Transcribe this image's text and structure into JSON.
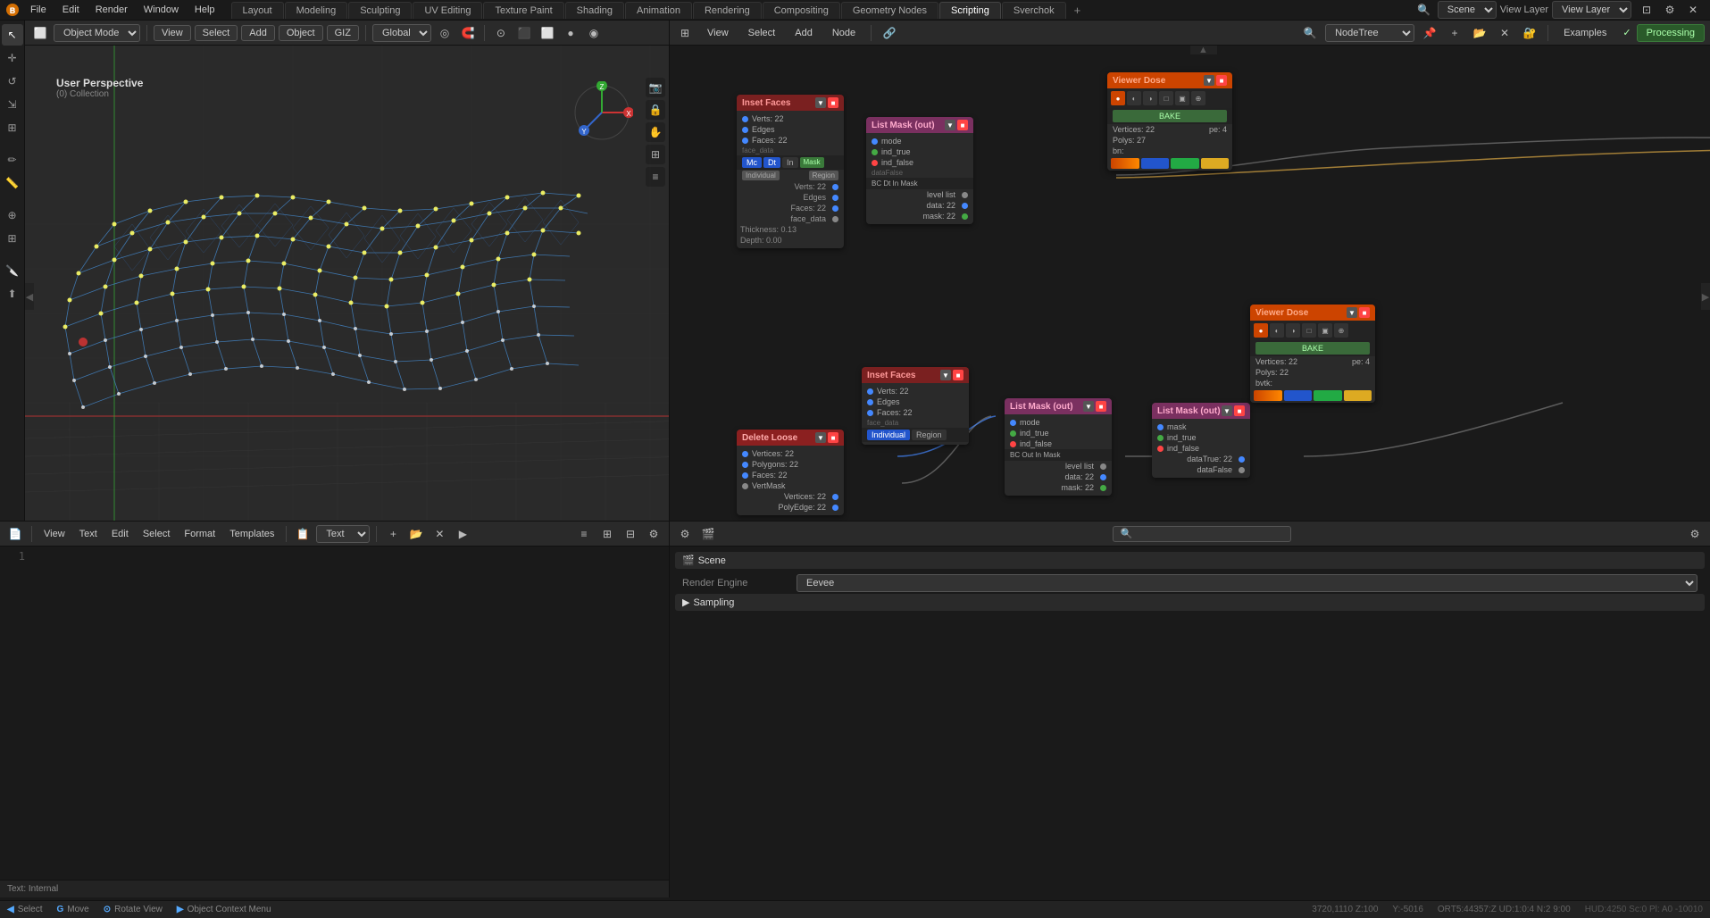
{
  "app": {
    "title": "Blender"
  },
  "topMenu": {
    "file": "File",
    "edit": "Edit",
    "render": "Render",
    "window": "Window",
    "help": "Help"
  },
  "workspaceTabs": [
    {
      "label": "Layout",
      "active": false
    },
    {
      "label": "Modeling",
      "active": false
    },
    {
      "label": "Sculpting",
      "active": false
    },
    {
      "label": "UV Editing",
      "active": false
    },
    {
      "label": "Texture Paint",
      "active": false
    },
    {
      "label": "Shading",
      "active": false
    },
    {
      "label": "Animation",
      "active": false
    },
    {
      "label": "Rendering",
      "active": false
    },
    {
      "label": "Compositing",
      "active": false
    },
    {
      "label": "Geometry Nodes",
      "active": false
    },
    {
      "label": "Scripting",
      "active": true
    },
    {
      "label": "Sverchok",
      "active": false
    }
  ],
  "viewport": {
    "mode": "Object Mode",
    "view_label": "View",
    "select_label": "Select",
    "add_label": "Add",
    "object_label": "Object",
    "giz_label": "GIZ",
    "transform_global": "Global",
    "info_title": "User Perspective",
    "info_collection": "(0) Collection"
  },
  "nodeEditor": {
    "view_label": "View",
    "select_label": "Select",
    "add_label": "Add",
    "node_label": "Node",
    "tree_label": "NodeTree"
  },
  "nodes": {
    "insetFaces1": {
      "title": "Inset Faces",
      "verts": "Verts: 22",
      "edges": "Edges",
      "faces": "Faces: 22",
      "faceData": "face_data",
      "individual": "Individual",
      "region": "Region",
      "vertsOut": "Verts: 22",
      "edgesOut": "Edges",
      "facesOut": "Faces: 22",
      "faceDataOut": "face_data",
      "thickness": "Thickness: 0.13",
      "depth": "Depth: 0.00"
    },
    "listMaskInput1": {
      "title": "List Mask (out)",
      "mode": "mode",
      "ind_true": "ind_true",
      "ind_false": "ind_false",
      "dataFalse": "dataFalse",
      "maskMode": "BC Dt In Mask",
      "levelList": "level list",
      "data": "data: 22",
      "mask": "mask: 22"
    },
    "insetFaces2": {
      "title": "Inset Faces",
      "verts": "Verts: 22",
      "edges": "Edges",
      "faces": "Faces: 22",
      "faceData": "face_data",
      "individual": "Individual",
      "region": "Region"
    },
    "deleteLoose": {
      "title": "Delete Loose",
      "vertices": "Vertices: 22",
      "polygons": "Polygons: 22",
      "faces": "Faces: 22",
      "vertMask": "VertMask",
      "verticesOut": "Vertices: 22",
      "polyEdge": "PolyEdge: 22"
    },
    "listMaskInput2": {
      "title": "List Mask (out)",
      "mode": "mode",
      "ind_true": "ind_true",
      "ind_false": "ind_false",
      "maskMode": "BC Out In Mask",
      "levelList": "level list",
      "data": "data: 22",
      "mask": "mask: 22"
    },
    "viewerDose1": {
      "title": "Viewer Dose",
      "bake": "BAKE",
      "vertices": "Vertices: 22",
      "pe": "pe: 4",
      "polys": "Polys: 27",
      "bn": "bn:"
    },
    "viewerDose2": {
      "title": "Viewer Dose",
      "bake": "BAKE",
      "vertices": "Vertices: 22",
      "pe": "pe: 4",
      "polys": "Polys: 22",
      "extra": "bvtk:"
    },
    "listMaskSmall": {
      "title": "List Mask (out)",
      "mask": "mask",
      "ind_true": "ind_true",
      "ind_false": "ind_false",
      "dataTrue": "dataTrue: 22",
      "dataFalse": "dataFalse"
    }
  },
  "textEditor": {
    "view": "View",
    "text": "Text",
    "edit": "Edit",
    "select": "Select",
    "format": "Format",
    "templates": "Templates",
    "filename": "Text",
    "status": "Text: Internal",
    "line": "1"
  },
  "propertiesPanel": {
    "scene_label": "Scene",
    "render_engine_label": "Render Engine",
    "render_engine_value": "Eevee",
    "sampling_label": "Sampling"
  },
  "statusBar": {
    "select": "Select",
    "select_key": "◀",
    "move": "Move",
    "move_key": "G",
    "rotate": "Rotate View",
    "rotate_key": "⊙",
    "context_menu": "Object Context Menu",
    "context_key": "▶",
    "coords": "3720,1110  Z:100",
    "extra_coords": "Y:-5016",
    "angles": "ORT5:44357:Z  UD:1:0:4  N:2  9:00",
    "hud_info": "HUD:4250  Sc:0  Pl: A0  -10010"
  },
  "viewLayer": {
    "label": "View Layer",
    "value": "View Layer"
  },
  "scene": {
    "label": "Scene",
    "value": "Scene"
  },
  "processing": {
    "label": "Processing"
  },
  "examples": {
    "label": "Examples"
  }
}
